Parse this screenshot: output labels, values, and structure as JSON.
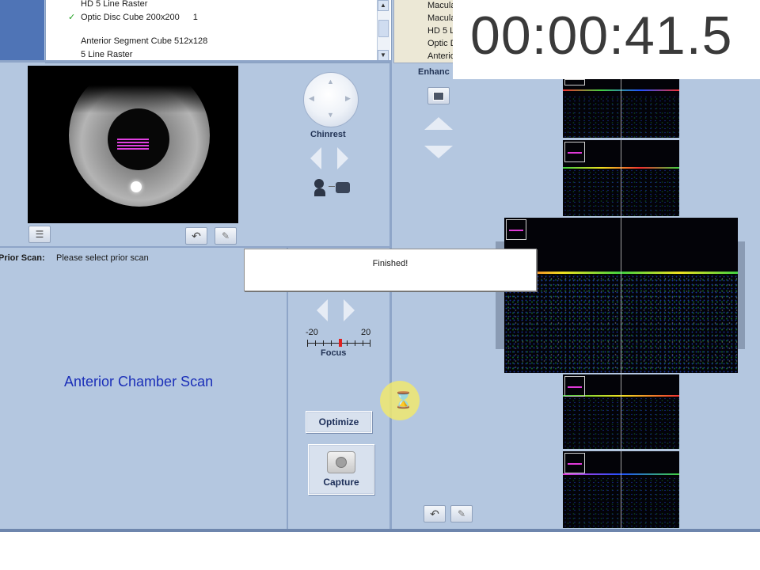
{
  "scan_list": {
    "items": [
      {
        "label": "HD 5 Line Raster",
        "check": "",
        "count": ""
      },
      {
        "label": "Optic Disc Cube 200x200",
        "check": "✓",
        "count": "1"
      },
      {
        "label": "",
        "check": "",
        "count": ""
      },
      {
        "label": "Anterior Segment Cube 512x128",
        "check": "",
        "count": ""
      },
      {
        "label": "5 Line Raster",
        "check": "",
        "count": ""
      }
    ]
  },
  "right_list": {
    "items": [
      "Macula",
      "Macula",
      "HD 5 L",
      "Optic D",
      "Anterio"
    ]
  },
  "timer": "00:00:41.5",
  "enhance_label": "Enhanc",
  "chinrest_label": "Chinrest",
  "focus": {
    "label": "Focus",
    "min": "-20",
    "max": "20",
    "value": 0.2
  },
  "prior_scan": {
    "label": "Prior Scan:",
    "value": "Please select prior scan"
  },
  "message": "Finished!",
  "scan_title": "Anterior Chamber Scan",
  "optimize_label": "Optimize",
  "capture_label": "Capture",
  "colors": {
    "panel": "#b4c7e0",
    "accent_text": "#1b2fb8",
    "focus_marker": "#e02020",
    "hourglass_ring": "#e8e27a"
  }
}
